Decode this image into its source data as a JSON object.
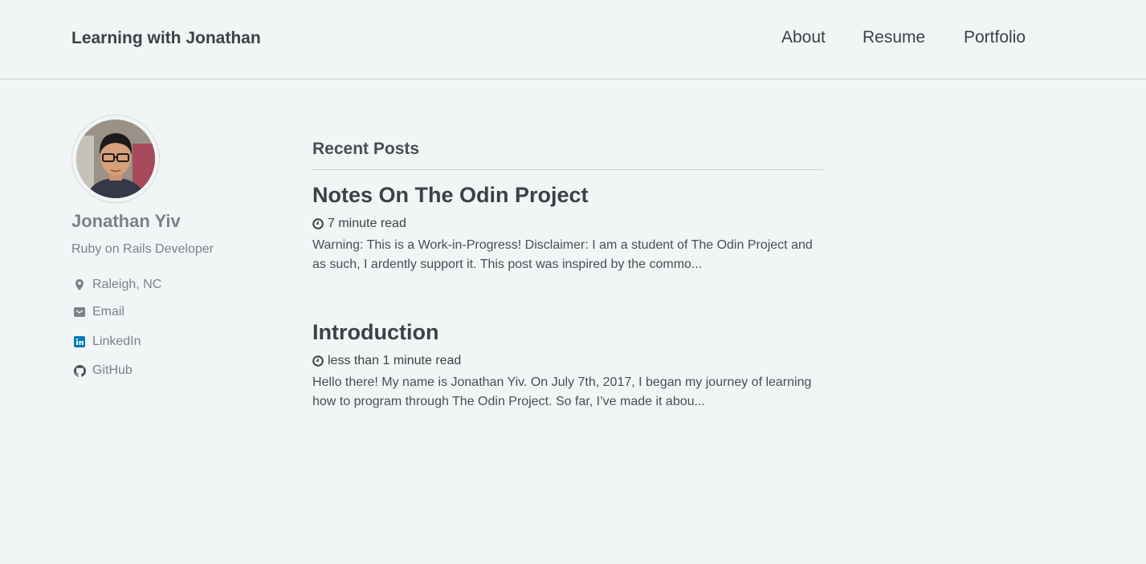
{
  "header": {
    "site_title": "Learning with Jonathan",
    "nav": [
      "About",
      "Resume",
      "Portfolio"
    ]
  },
  "author": {
    "name": "Jonathan Yiv",
    "bio": "Ruby on Rails Developer",
    "links": [
      {
        "label": "Raleigh, NC",
        "icon": "map-marker-icon"
      },
      {
        "label": "Email",
        "icon": "envelope-icon"
      },
      {
        "label": "LinkedIn",
        "icon": "linkedin-icon"
      },
      {
        "label": "GitHub",
        "icon": "github-icon"
      }
    ]
  },
  "main": {
    "heading": "Recent Posts",
    "posts": [
      {
        "title": "Notes On The Odin Project",
        "read_time": "7 minute read",
        "excerpt": "Warning: This is a Work-in-Progress! Disclaimer: I am a student of The Odin Project and as such, I ardently support it. This post was inspired by the commo..."
      },
      {
        "title": "Introduction",
        "read_time": "less than 1 minute read",
        "excerpt": "Hello there! My name is Jonathan Yiv. On July 7th, 2017, I began my journey of learning how to program through The Odin Project. So far, I’ve made it abou..."
      }
    ]
  },
  "colors": {
    "background": "#f2f5f6",
    "text": "#494e52",
    "muted": "#7a8288",
    "linkedin": "#007bb6"
  }
}
